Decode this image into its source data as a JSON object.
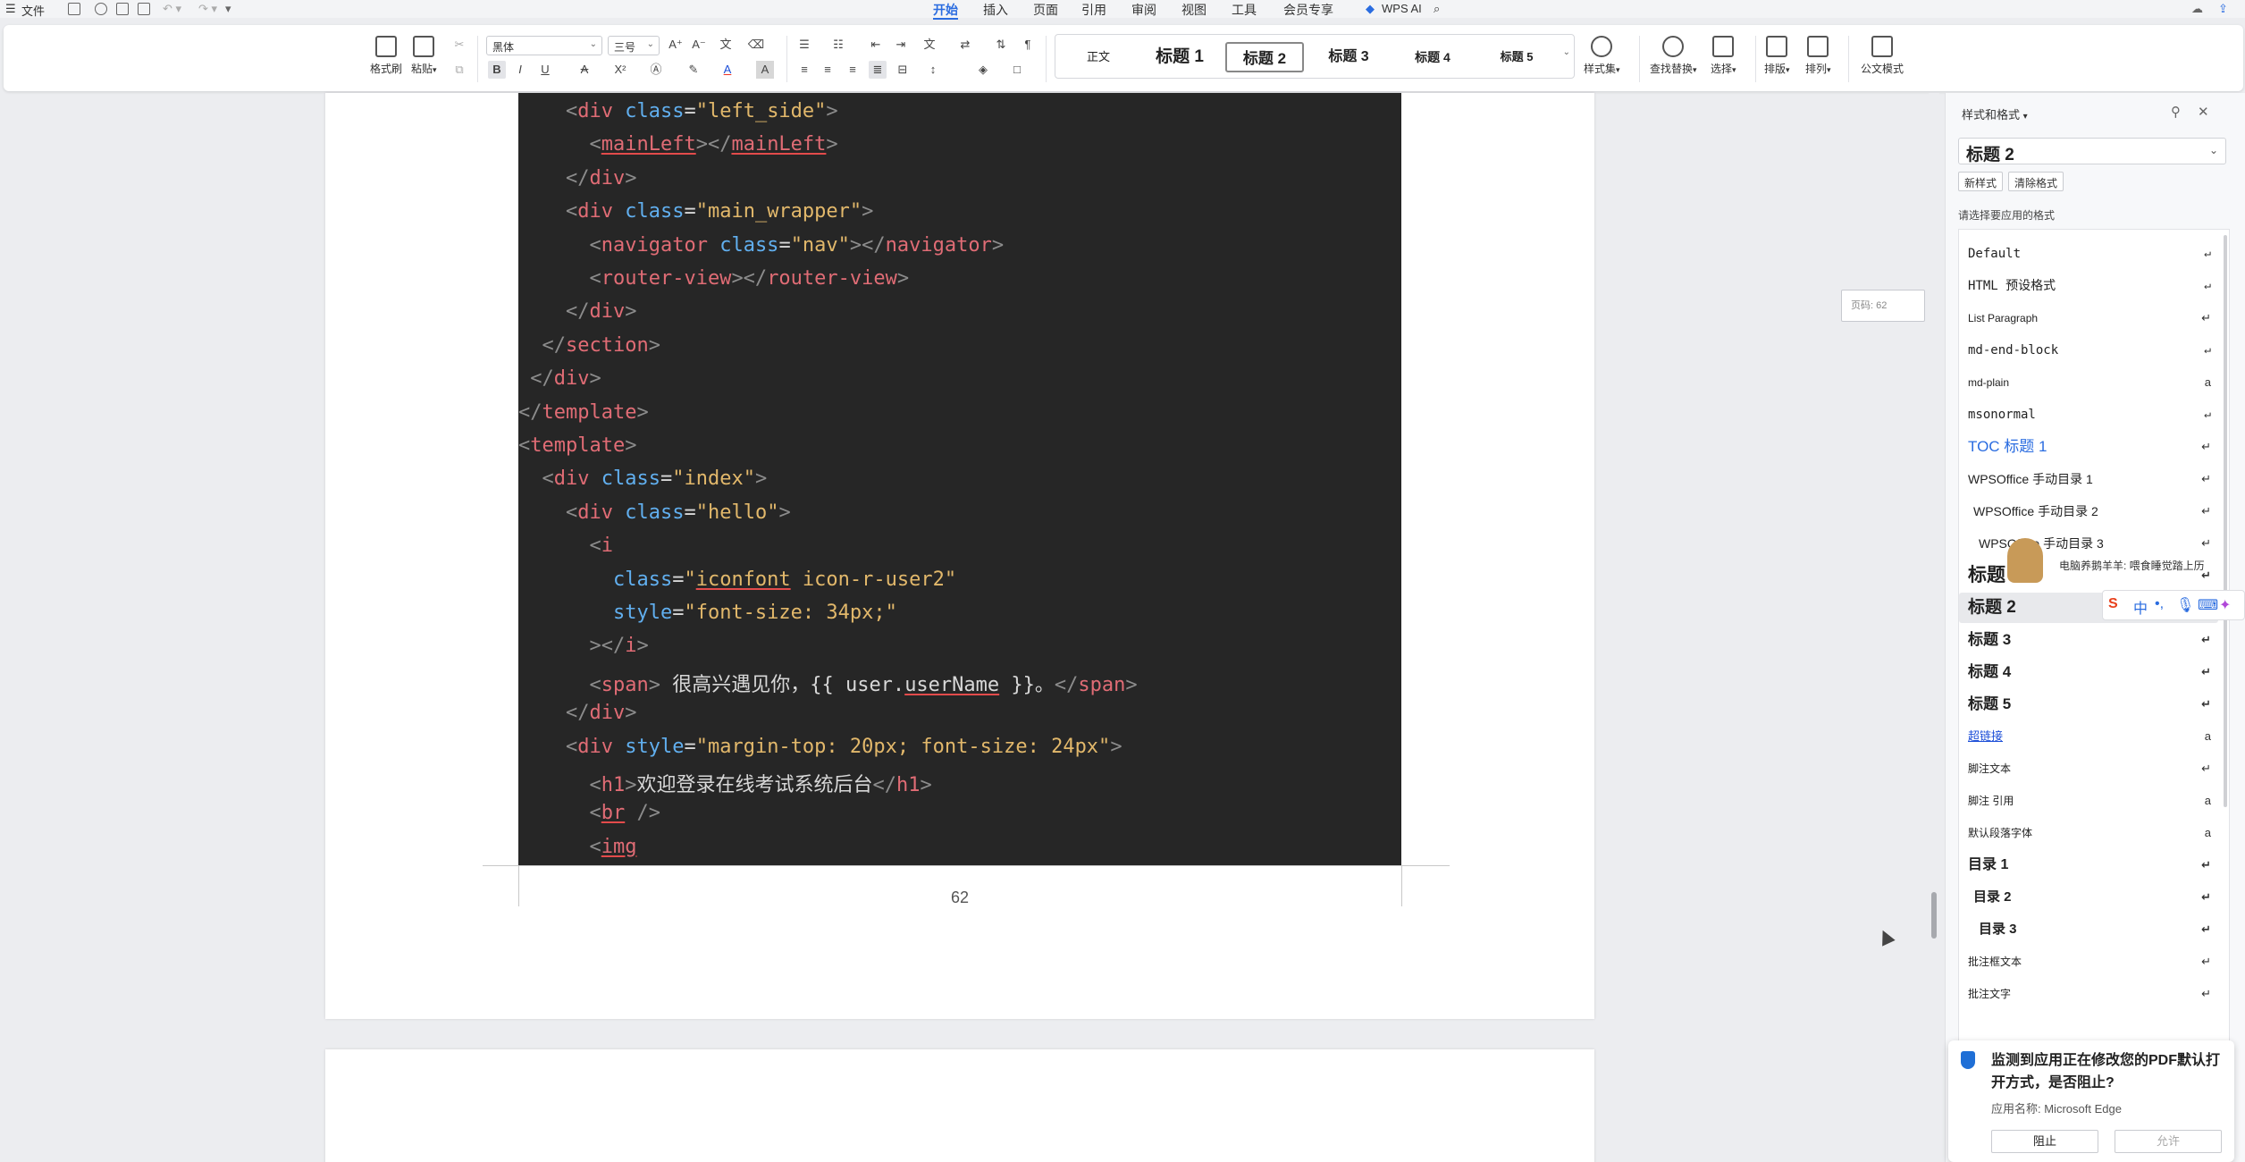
{
  "menubar": {
    "file": "文件",
    "tabs": [
      "开始",
      "插入",
      "页面",
      "引用",
      "审阅",
      "视图",
      "工具",
      "会员专享"
    ],
    "active_tab": "开始",
    "wps_ai": "WPS AI"
  },
  "ribbon": {
    "format_painter": "格式刷",
    "paste": "粘贴",
    "font_name": "黑体",
    "font_size": "三号",
    "gallery": [
      "正文",
      "标题 1",
      "标题 2",
      "标题 3",
      "标题 4",
      "标题 5"
    ],
    "gallery_selected": "标题 2",
    "style_set": "样式集",
    "find_replace": "查找替换",
    "select": "选择",
    "layout": "排版",
    "arrange": "排列",
    "official_mode": "公文模式"
  },
  "document": {
    "code_lines": [
      [
        [
          "    ",
          "x"
        ],
        [
          "<",
          "p"
        ],
        [
          "div",
          "t"
        ],
        [
          " ",
          "x"
        ],
        [
          "class",
          "a"
        ],
        [
          "=",
          "x"
        ],
        [
          "\"left_side\"",
          "s"
        ],
        [
          ">",
          "p"
        ]
      ],
      [
        [
          "      ",
          "x"
        ],
        [
          "<",
          "p"
        ],
        [
          "mainLeft",
          "tu"
        ],
        [
          "></",
          "p"
        ],
        [
          "mainLeft",
          "tu"
        ],
        [
          ">",
          "p"
        ]
      ],
      [
        [
          "    ",
          "x"
        ],
        [
          "</",
          "p"
        ],
        [
          "div",
          "t"
        ],
        [
          ">",
          "p"
        ]
      ],
      [
        [
          "    ",
          "x"
        ],
        [
          "<",
          "p"
        ],
        [
          "div",
          "t"
        ],
        [
          " ",
          "x"
        ],
        [
          "class",
          "a"
        ],
        [
          "=",
          "x"
        ],
        [
          "\"main_wrapper\"",
          "s"
        ],
        [
          ">",
          "p"
        ]
      ],
      [
        [
          "      ",
          "x"
        ],
        [
          "<",
          "p"
        ],
        [
          "navigator",
          "t"
        ],
        [
          " ",
          "x"
        ],
        [
          "class",
          "a"
        ],
        [
          "=",
          "x"
        ],
        [
          "\"nav\"",
          "s"
        ],
        [
          "></",
          "p"
        ],
        [
          "navigator",
          "t"
        ],
        [
          ">",
          "p"
        ]
      ],
      [
        [
          "      ",
          "x"
        ],
        [
          "<",
          "p"
        ],
        [
          "router-view",
          "t"
        ],
        [
          "></",
          "p"
        ],
        [
          "router-view",
          "t"
        ],
        [
          ">",
          "p"
        ]
      ],
      [
        [
          "    ",
          "x"
        ],
        [
          "</",
          "p"
        ],
        [
          "div",
          "t"
        ],
        [
          ">",
          "p"
        ]
      ],
      [
        [
          "  ",
          "x"
        ],
        [
          "</",
          "p"
        ],
        [
          "section",
          "t"
        ],
        [
          ">",
          "p"
        ]
      ],
      [
        [
          " ",
          "x"
        ],
        [
          "</",
          "p"
        ],
        [
          "div",
          "t"
        ],
        [
          ">",
          "p"
        ]
      ],
      [
        [
          "</",
          "p"
        ],
        [
          "template",
          "t"
        ],
        [
          ">",
          "p"
        ]
      ],
      [
        [
          "<",
          "p"
        ],
        [
          "template",
          "t"
        ],
        [
          ">",
          "p"
        ]
      ],
      [
        [
          "  ",
          "x"
        ],
        [
          "<",
          "p"
        ],
        [
          "div",
          "t"
        ],
        [
          " ",
          "x"
        ],
        [
          "class",
          "a"
        ],
        [
          "=",
          "x"
        ],
        [
          "\"index\"",
          "s"
        ],
        [
          ">",
          "p"
        ]
      ],
      [
        [
          "    ",
          "x"
        ],
        [
          "<",
          "p"
        ],
        [
          "div",
          "t"
        ],
        [
          " ",
          "x"
        ],
        [
          "class",
          "a"
        ],
        [
          "=",
          "x"
        ],
        [
          "\"hello\"",
          "s"
        ],
        [
          ">",
          "p"
        ]
      ],
      [
        [
          "      ",
          "x"
        ],
        [
          "<",
          "p"
        ],
        [
          "i",
          "t"
        ]
      ],
      [
        [
          "        ",
          "x"
        ],
        [
          "class",
          "a"
        ],
        [
          "=",
          "x"
        ],
        [
          "\"",
          "s"
        ],
        [
          "iconfont",
          "su"
        ],
        [
          " icon-r-user2\"",
          "s"
        ]
      ],
      [
        [
          "        ",
          "x"
        ],
        [
          "style",
          "a"
        ],
        [
          "=",
          "x"
        ],
        [
          "\"font-size: 34px;\"",
          "s"
        ]
      ],
      [
        [
          "      ",
          "x"
        ],
        [
          "></",
          "p"
        ],
        [
          "i",
          "t"
        ],
        [
          ">",
          "p"
        ]
      ],
      [
        [
          "      ",
          "x"
        ],
        [
          "<",
          "p"
        ],
        [
          "span",
          "t"
        ],
        [
          ">",
          "p"
        ],
        [
          " 很高兴遇见你，{{ user.",
          "x"
        ],
        [
          "userName",
          "xu"
        ],
        [
          " }}。",
          "x"
        ],
        [
          "</",
          "p"
        ],
        [
          "span",
          "t"
        ],
        [
          ">",
          "p"
        ]
      ],
      [
        [
          "    ",
          "x"
        ],
        [
          "</",
          "p"
        ],
        [
          "div",
          "t"
        ],
        [
          ">",
          "p"
        ]
      ],
      [
        [
          "    ",
          "x"
        ],
        [
          "<",
          "p"
        ],
        [
          "div",
          "t"
        ],
        [
          " ",
          "x"
        ],
        [
          "style",
          "a"
        ],
        [
          "=",
          "x"
        ],
        [
          "\"margin-top: 20px; font-size: 24px\"",
          "s"
        ],
        [
          ">",
          "p"
        ]
      ],
      [
        [
          "      ",
          "x"
        ],
        [
          "<",
          "p"
        ],
        [
          "h1",
          "t"
        ],
        [
          ">",
          "p"
        ],
        [
          "欢迎登录在线考试系统后台",
          "x"
        ],
        [
          "</",
          "p"
        ],
        [
          "h1",
          "t"
        ],
        [
          ">",
          "p"
        ]
      ],
      [
        [
          "      ",
          "x"
        ],
        [
          "<",
          "p"
        ],
        [
          "br",
          "tu"
        ],
        [
          " />",
          "p"
        ]
      ],
      [
        [
          "      ",
          "x"
        ],
        [
          "<",
          "p"
        ],
        [
          "img",
          "tu"
        ]
      ]
    ],
    "page_number": "62",
    "page_tip": "页码: 62"
  },
  "panel": {
    "title": "样式和格式",
    "current_style": "标题 2",
    "new_style": "新样式",
    "clear_format": "清除格式",
    "pick_label": "请选择要应用的格式",
    "styles": [
      {
        "label": "Default",
        "icon": "↵",
        "kind": "mono"
      },
      {
        "label": "HTML 预设格式",
        "icon": "↵",
        "kind": "mono"
      },
      {
        "label": "List Paragraph",
        "icon": "↵",
        "kind": "small"
      },
      {
        "label": "md-end-block",
        "icon": "↵",
        "kind": "mono"
      },
      {
        "label": "md-plain",
        "icon": "a",
        "kind": "small"
      },
      {
        "label": "msonormal",
        "icon": "↵",
        "kind": "mono"
      },
      {
        "label": "TOC 标题 1",
        "icon": "↵",
        "kind": "toc"
      },
      {
        "label": "WPSOffice 手动目录 1",
        "icon": "↵",
        "kind": "normal"
      },
      {
        "label": "WPSOffice 手动目录 2",
        "icon": "↵",
        "kind": "indent1"
      },
      {
        "label": "WPSOffice 手动目录 3",
        "icon": "↵",
        "kind": "indent2"
      },
      {
        "label": "标题 1",
        "icon": "↵",
        "kind": "h1"
      },
      {
        "label": "标题 2",
        "icon": "↵",
        "kind": "h2"
      },
      {
        "label": "标题 3",
        "icon": "↵",
        "kind": "h3"
      },
      {
        "label": "标题 4",
        "icon": "↵",
        "kind": "h3"
      },
      {
        "label": "标题 5",
        "icon": "↵",
        "kind": "h3"
      },
      {
        "label": "超链接",
        "icon": "a",
        "kind": "link"
      },
      {
        "label": "脚注文本",
        "icon": "↵",
        "kind": "small"
      },
      {
        "label": "脚注 引用",
        "icon": "a",
        "kind": "small"
      },
      {
        "label": "默认段落字体",
        "icon": "a",
        "kind": "small"
      },
      {
        "label": "目录 1",
        "icon": "↵",
        "kind": "toc1"
      },
      {
        "label": "目录 2",
        "icon": "↵",
        "kind": "toc2"
      },
      {
        "label": "目录 3",
        "icon": "↵",
        "kind": "toc3"
      },
      {
        "label": "批注框文本",
        "icon": "↵",
        "kind": "small"
      },
      {
        "label": "批注文字",
        "icon": "↵",
        "kind": "small"
      }
    ],
    "selected_index": 11
  },
  "ime": {
    "tip": "电脑养鹅羊羊: 喂食睡觉踏上历",
    "lang": "中"
  },
  "notification": {
    "title": "监测到应用正在修改您的PDF默认打开方式，是否阻止?",
    "app": "应用名称: Microsoft Edge",
    "block": "阻止",
    "allow": "允许"
  },
  "colors": {
    "accent": "#2a6ce0",
    "code_bg": "#262626",
    "tag": "#e06c75",
    "attr": "#61afef",
    "string": "#e2b86b"
  }
}
